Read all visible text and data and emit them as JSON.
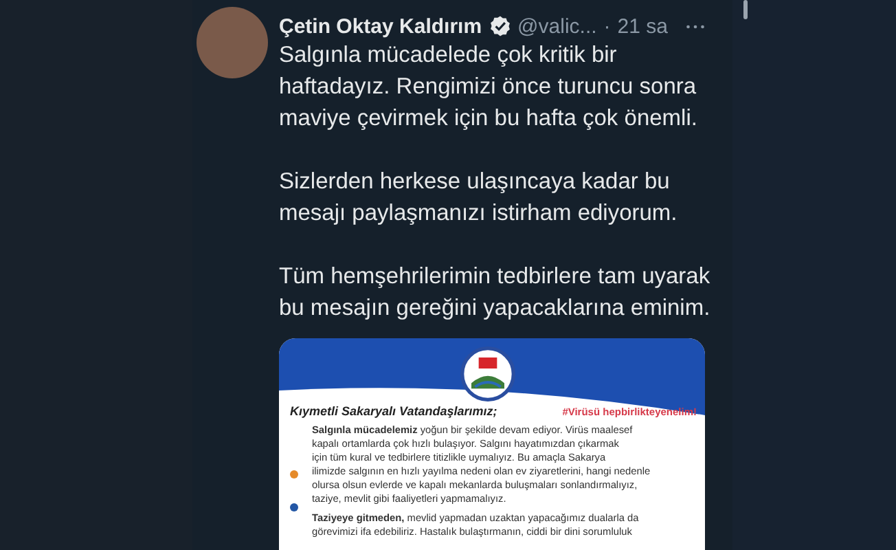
{
  "tweet": {
    "author": "Çetin Oktay Kaldırım",
    "verified": true,
    "handle": "@valic...",
    "separator": "·",
    "time": "21 sa",
    "paragraphs": [
      "Salgınla mücadelede çok kritik bir\nhaftadayız. Rengimizi önce turuncu sonra\nmaviye çevirmek için bu hafta çok önemli.",
      "Sizlerden herkese ulaşıncaya kadar bu\nmesajı paylaşmanızı istirham ediyorum.",
      "Tüm hemşehrilerimin tedbirlere tam uyarak\nbu mesajın gereğini yapacaklarına eminim."
    ],
    "attachment": {
      "hashtag": "#Virüsü hepbirlikteyenelim!",
      "greeting": "Kıymetli Sakaryalı Vatandaşlarımız;",
      "paragraphs": [
        "**Salgınla mücadelemiz** yoğun bir şekilde devam ediyor. Virüs maalesef\nkapalı ortamlarda çok hızlı bulaşıyor. Salgını hayatımızdan çıkarmak\niçin tüm kural ve tedbirlere titizlikle uymalıyız.  Bu amaçla Sakarya\nilimizde salgının en hızlı yayılma nedeni olan ev ziyaretlerini, hangi nedenle\nolursa olsun evlerde ve kapalı mekanlarda buluşmaları sonlandırmalıyız,\ntaziye, mevlit gibi faaliyetleri yapmamalıyız.",
        "**Taziyeye gitmeden,** mevlid yapmadan uzaktan yapacağımız dualarla da\ngörevimizi ifa edebiliriz. Hastalık bulaştırmanın, ciddi bir dini sorumluluk"
      ]
    }
  }
}
